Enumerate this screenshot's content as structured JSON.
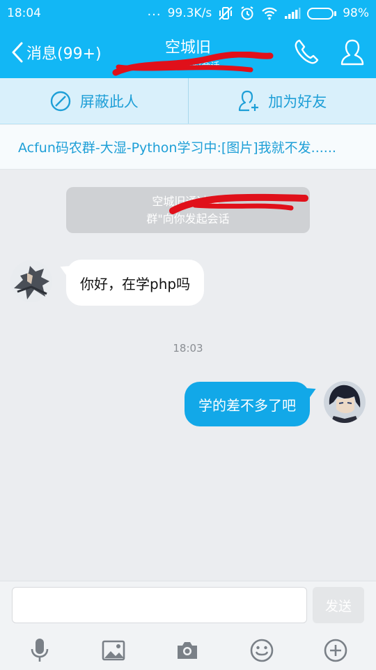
{
  "status_bar": {
    "time": "18:04",
    "dots": "...",
    "net_speed": "99.3K/s",
    "battery_percent": "98%",
    "battery_level": 0.98
  },
  "header": {
    "back_label": "消息(99+)",
    "title": "空城旧",
    "subtitle": "来自群临时会话"
  },
  "actions": {
    "block_label": "屏蔽此人",
    "add_friend_label": "加为好友"
  },
  "group_banner": "Acfun码农群-大湿-Python学习中:[图片]我就不发......",
  "chat": {
    "system_tip_line1": "空城旧通过群\"",
    "system_tip_line2": "群\"向你发起会话",
    "incoming_message": "你好，在学php吗",
    "time_divider": "18:03",
    "outgoing_message": "学的差不多了吧"
  },
  "composer": {
    "input_value": "",
    "send_label": "发送"
  },
  "colors": {
    "accent": "#12b7f5",
    "bubble_out": "#12a8e8",
    "redaction": "#e0101a"
  }
}
